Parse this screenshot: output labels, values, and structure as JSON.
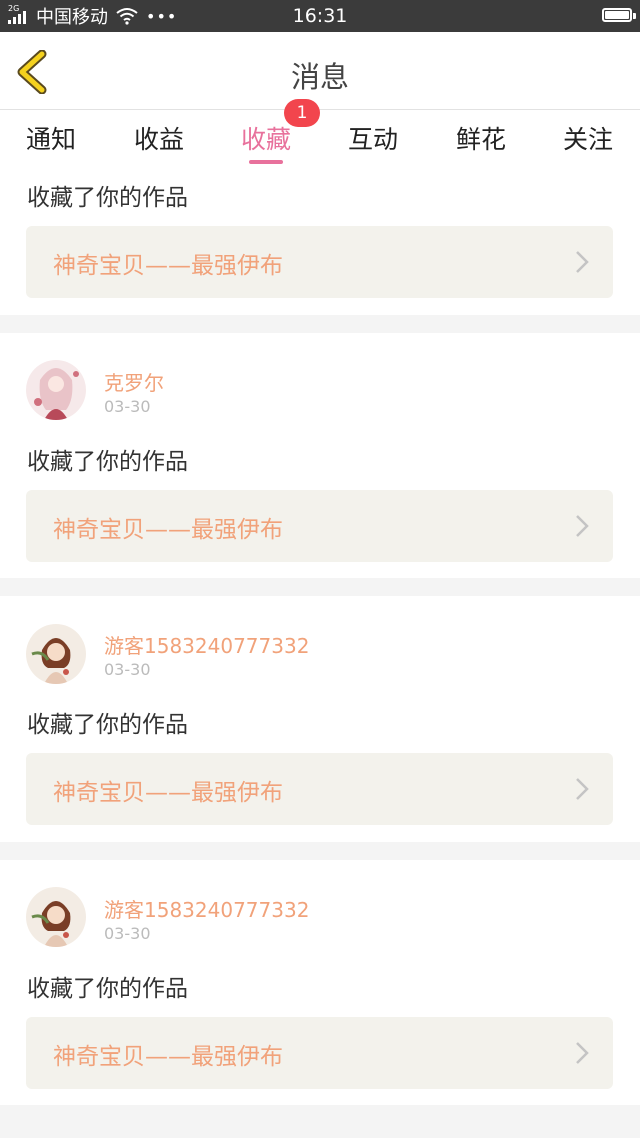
{
  "status_bar": {
    "network": "2G",
    "carrier": "中国移动",
    "dots": "•••",
    "time": "16:31"
  },
  "header": {
    "title": "消息"
  },
  "tabs": [
    {
      "label": "通知"
    },
    {
      "label": "收益"
    },
    {
      "label": "收藏",
      "badge": "1",
      "active": true
    },
    {
      "label": "互动"
    },
    {
      "label": "鲜花"
    },
    {
      "label": "关注"
    }
  ],
  "colors": {
    "accent": "#e8719c",
    "orange_text": "#f1a27a",
    "badge": "#f2454d"
  },
  "items": [
    {
      "action": "收藏了你的作品",
      "work_title": "神奇宝贝——最强伊布"
    },
    {
      "user": "克罗尔",
      "date": "03-30",
      "action": "收藏了你的作品",
      "work_title": "神奇宝贝——最强伊布"
    },
    {
      "user": "游客1583240777332",
      "date": "03-30",
      "action": "收藏了你的作品",
      "work_title": "神奇宝贝——最强伊布"
    },
    {
      "user": "游客1583240777332",
      "date": "03-30",
      "action": "收藏了你的作品",
      "work_title": "神奇宝贝——最强伊布"
    }
  ]
}
